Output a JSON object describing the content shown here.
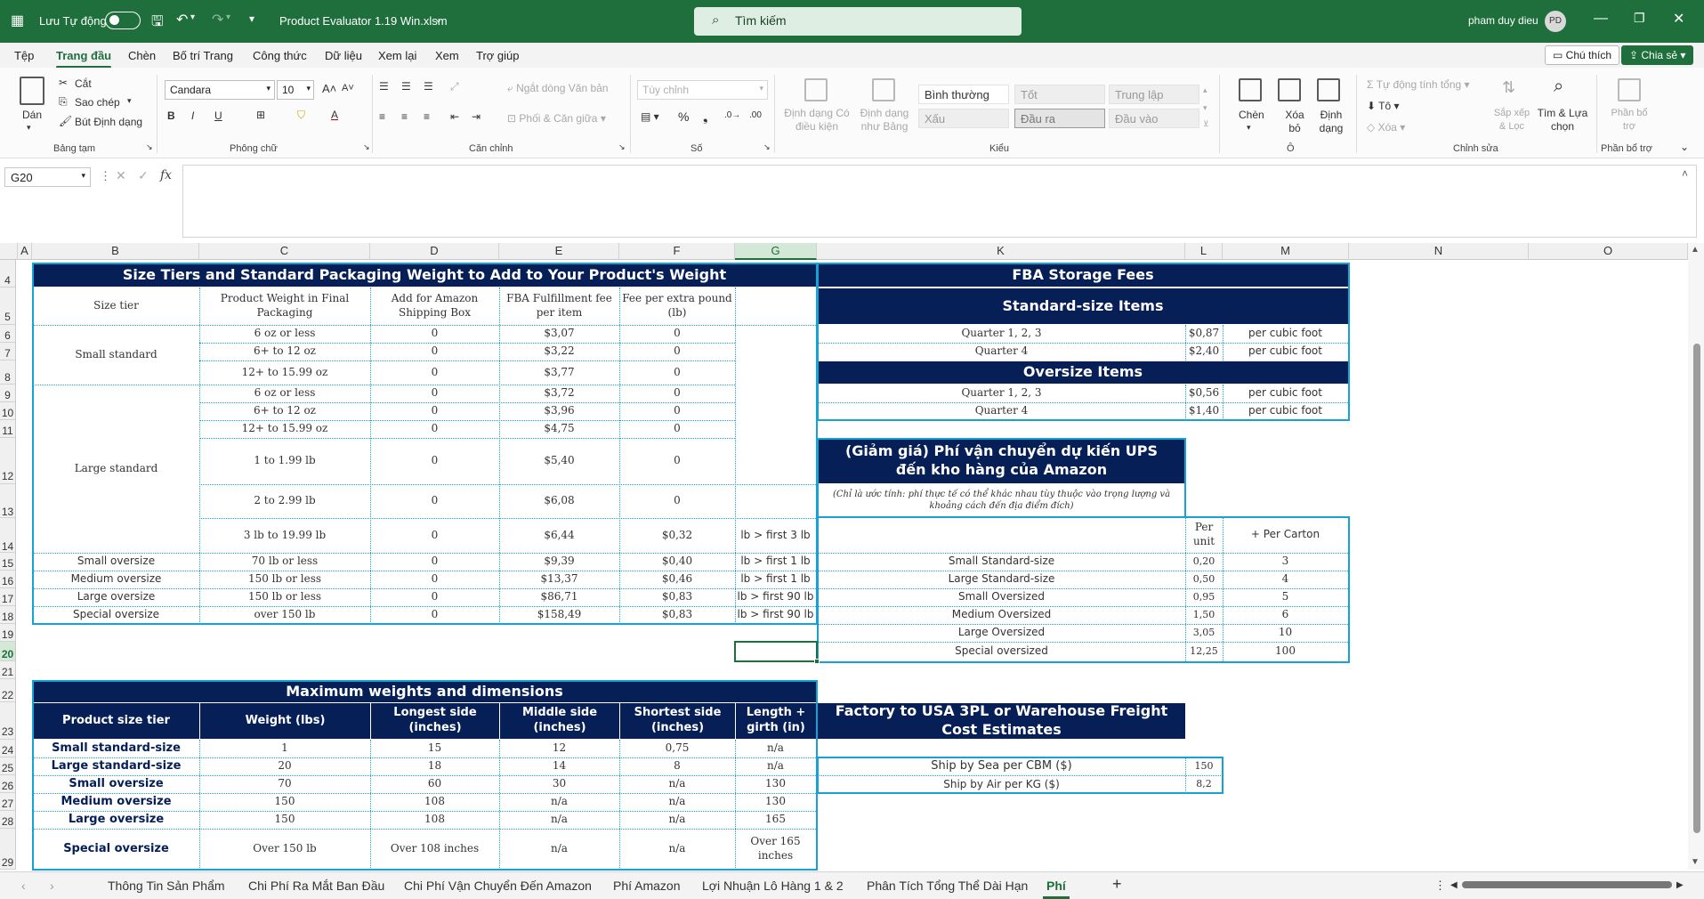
{
  "titlebar": {
    "autosave": "Lưu Tự động",
    "filename": "Product Evaluator 1.19 Win.xlsm",
    "search": "Tìm kiếm",
    "user": "pham duy dieu",
    "initials": "PD"
  },
  "menu": {
    "items": [
      "Tệp",
      "Trang đầu",
      "Chèn",
      "Bố trí Trang",
      "Công thức",
      "Dữ liệu",
      "Xem lại",
      "Xem",
      "Trợ giúp"
    ],
    "comment_btn": "Chú thích",
    "share_btn": "Chia sẻ"
  },
  "ribbon": {
    "paste": "Dán",
    "cut": "Cắt",
    "copy": "Sao chép",
    "format_painter": "Bút Định dạng",
    "clipboard": "Bảng tạm",
    "font_name": "Candara",
    "font_size": "10",
    "font": "Phông chữ",
    "wrap": "Ngắt dòng Văn bản",
    "merge": "Phối & Căn giữa",
    "alignment": "Căn chỉnh",
    "number_format": "Tùy chỉnh",
    "number": "Số",
    "cond_format": "Định dạng Có điều kiện",
    "format_table": "Định dạng như Bảng",
    "styles_items": [
      "Bình thường",
      "Tốt",
      "Trung lập",
      "Xấu",
      "Đầu ra",
      "Đầu vào"
    ],
    "styles": "Kiểu",
    "insert": "Chèn",
    "delete": "Xóa bỏ",
    "format": "Định dạng",
    "cells": "Ô",
    "autosum": "Tự động tính tổng",
    "fill": "Tô",
    "clear": "Xóa",
    "sort": "Sắp xếp & Lọc",
    "find": "Tìm & Lựa chọn",
    "editing": "Chỉnh sửa",
    "addins": "Phần bổ trợ",
    "addins_group": "Phần bổ trợ"
  },
  "formula": {
    "namebox": "G20",
    "fx": "fx"
  },
  "columns": [
    "A",
    "B",
    "C",
    "D",
    "E",
    "F",
    "G",
    "K",
    "L",
    "M",
    "N",
    "O"
  ],
  "rows": [
    "4",
    "5",
    "6",
    "7",
    "8",
    "9",
    "10",
    "11",
    "12",
    "13",
    "14",
    "15",
    "16",
    "17",
    "18",
    "19",
    "20",
    "21",
    "22",
    "23",
    "24",
    "25",
    "26",
    "27",
    "28",
    "29"
  ],
  "table1": {
    "title": "Size Tiers and Standard Packaging Weight to Add to Your Product's Weight",
    "headers": [
      "Size tier",
      "Product Weight in Final Packaging",
      "Add for Amazon Shipping Box",
      "FBA Fulfillment fee per item",
      "Fee per extra pound (lb)"
    ],
    "tiers": [
      "Small standard",
      "Large standard"
    ],
    "rows": [
      [
        "",
        "6 oz or less",
        "0",
        "$3,07",
        "0",
        ""
      ],
      [
        "",
        "6+ to 12 oz",
        "0",
        "$3,22",
        "0",
        ""
      ],
      [
        "",
        "12+ to 15.99 oz",
        "0",
        "$3,77",
        "0",
        ""
      ],
      [
        "",
        "6 oz or less",
        "0",
        "$3,72",
        "0",
        ""
      ],
      [
        "",
        "6+ to 12 oz",
        "0",
        "$3,96",
        "0",
        ""
      ],
      [
        "",
        "12+ to 15.99 oz",
        "0",
        "$4,75",
        "0",
        ""
      ],
      [
        "",
        "1 to 1.99 lb",
        "0",
        "$5,40",
        "0",
        ""
      ],
      [
        "",
        "2 to 2.99 lb",
        "0",
        "$6,08",
        "0",
        ""
      ],
      [
        "",
        "3 lb to 19.99 lb",
        "0",
        "$6,44",
        "$0,32",
        "lb > first 3 lb"
      ],
      [
        "Small oversize",
        "70 lb or less",
        "0",
        "$9,39",
        "$0,40",
        "lb > first 1 lb"
      ],
      [
        "Medium oversize",
        "150 lb or less",
        "0",
        "$13,37",
        "$0,46",
        "lb > first 1 lb"
      ],
      [
        "Large oversize",
        "150 lb or less",
        "0",
        "$86,71",
        "$0,83",
        "lb > first 90 lb"
      ],
      [
        "Special oversize",
        "over 150 lb",
        "0",
        "$158,49",
        "$0,83",
        "lb > first 90 lb"
      ]
    ]
  },
  "storage": {
    "title": "FBA Storage Fees",
    "standard": "Standard-size Items",
    "oversize": "Oversize Items",
    "standard_rows": [
      [
        "Quarter 1, 2, 3",
        "$0,87",
        "per cubic foot"
      ],
      [
        "Quarter 4",
        "$2,40",
        "per cubic foot"
      ]
    ],
    "oversize_rows": [
      [
        "Quarter 1, 2, 3",
        "$0,56",
        "per cubic foot"
      ],
      [
        "Quarter 4",
        "$1,40",
        "per cubic foot"
      ]
    ]
  },
  "ups": {
    "title": "(Giảm giá) Phí vận chuyển dự kiến UPS đến kho hàng của Amazon",
    "note": "(Chỉ là ước tính: phí thực tế có thể khác nhau tùy thuộc vào trọng lượng và khoảng cách đến địa điểm đích)",
    "per_unit": "Per unit",
    "per_carton": "+ Per Carton",
    "rows": [
      [
        "Small Standard-size",
        "0,20",
        "3"
      ],
      [
        "Large Standard-size",
        "0,50",
        "4"
      ],
      [
        "Small Oversized",
        "0,95",
        "5"
      ],
      [
        "Medium Oversized",
        "1,50",
        "6"
      ],
      [
        "Large Oversized",
        "3,05",
        "10"
      ],
      [
        "Special oversized",
        "12,25",
        "100"
      ]
    ]
  },
  "table2": {
    "title": "Maximum weights and dimensions",
    "headers": [
      "Product size tier",
      "Weight (lbs)",
      "Longest side (inches)",
      "Middle side (inches)",
      "Shortest side (inches)",
      "Length + girth (in)"
    ],
    "rows": [
      [
        "Small standard-size",
        "1",
        "15",
        "12",
        "0,75",
        "n/a"
      ],
      [
        "Large standard-size",
        "20",
        "18",
        "14",
        "8",
        "n/a"
      ],
      [
        "Small oversize",
        "70",
        "60",
        "30",
        "n/a",
        "130"
      ],
      [
        "Medium oversize",
        "150",
        "108",
        "n/a",
        "n/a",
        "130"
      ],
      [
        "Large oversize",
        "150",
        "108",
        "n/a",
        "n/a",
        "165"
      ],
      [
        "Special oversize",
        "Over 150 lb",
        "Over 108 inches",
        "n/a",
        "n/a",
        "Over 165 inches"
      ]
    ]
  },
  "freight": {
    "title": "Factory to USA 3PL or Warehouse Freight Cost Estimates",
    "rows": [
      [
        "Ship by Sea per CBM ($)",
        "150"
      ],
      [
        "Ship by Air per KG ($)",
        "8,2"
      ]
    ]
  },
  "tabs": [
    "Thông Tin Sản Phẩm",
    "Chi Phí Ra Mắt Ban Đầu",
    "Chi Phí Vận Chuyển Đến Amazon",
    "Phí Amazon",
    "Lợi Nhuận Lô Hàng 1 & 2",
    "Phân Tích Tổng Thể Dài Hạn",
    "Phí"
  ],
  "colors": {
    "brand": "#1e6f3b",
    "header_navy": "#061f57",
    "grid_blue": "#16a2d3"
  }
}
